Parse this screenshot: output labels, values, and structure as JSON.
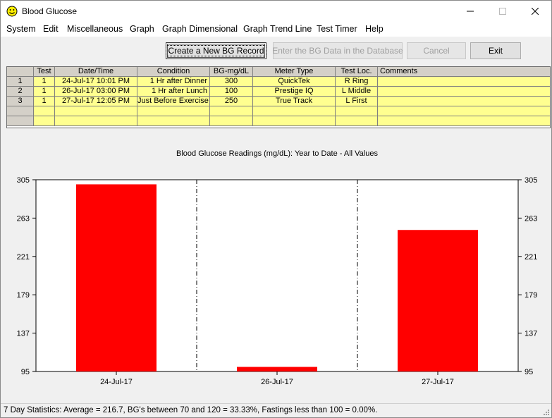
{
  "window": {
    "title": "Blood Glucose"
  },
  "menu": [
    "System",
    "Edit",
    "Miscellaneous",
    "Graph",
    "Graph Dimensional",
    "Graph Trend Line",
    "Test Timer",
    "Help"
  ],
  "toolbar": {
    "create": "Create a New BG Record",
    "enter": "Enter the BG  Data in the Database",
    "cancel": "Cancel",
    "exit": "Exit"
  },
  "grid": {
    "columns": [
      "",
      "Test",
      "Date/Time",
      "Condition",
      "BG-mg/dL",
      "Meter Type",
      "Test Loc.",
      "Comments"
    ],
    "rows": [
      [
        "1",
        "1",
        "24-Jul-17  10:01 PM",
        "1 Hr after Dinner",
        "300",
        "QuickTek",
        "R Ring",
        ""
      ],
      [
        "2",
        "1",
        "26-Jul-17  03:00 PM",
        "1 Hr after Lunch",
        "100",
        "Prestige IQ",
        "L Middle",
        ""
      ],
      [
        "3",
        "1",
        "27-Jul-17  12:05 PM",
        "Just Before Exercise",
        "250",
        "True Track",
        "L First",
        ""
      ],
      [
        "",
        "",
        "",
        "",
        "",
        "",
        "",
        ""
      ],
      [
        "",
        "",
        "",
        "",
        "",
        "",
        "",
        ""
      ]
    ]
  },
  "chart_data": {
    "type": "bar",
    "title": "Blood Glucose Readings (mg/dL): Year to Date - All Values",
    "categories": [
      "24-Jul-17",
      "26-Jul-17",
      "27-Jul-17"
    ],
    "values": [
      300,
      100,
      250
    ],
    "ylim": [
      95,
      305
    ],
    "yticks": [
      "305",
      "263",
      "221",
      "179",
      "137",
      "95"
    ],
    "bar_color": "#ff0000",
    "grid": "vertical dashed separators",
    "legend": "none"
  },
  "status": {
    "text": "7 Day Statistics: Average = 216.7, BG's between 70 and 120 = 33.33%, Fastings less than 100 = 0.00%."
  },
  "colors": {
    "grid_row": "#ffff90",
    "grid_header": "#d4d0c8",
    "bar": "#ff0000"
  }
}
